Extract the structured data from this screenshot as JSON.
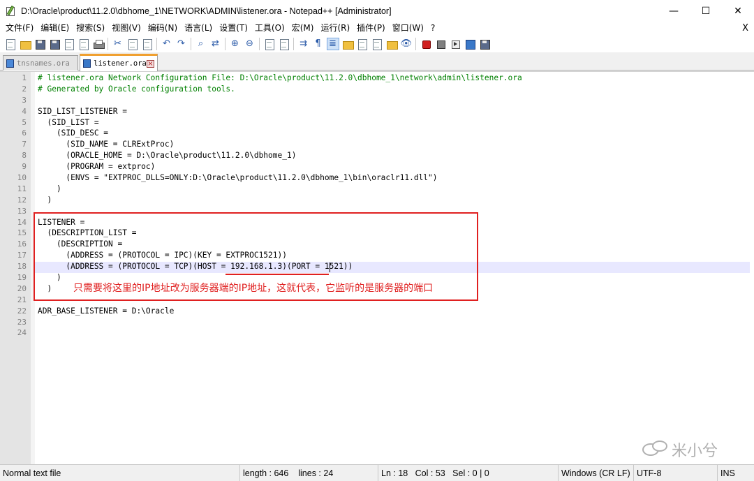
{
  "window": {
    "title": "D:\\Oracle\\product\\11.2.0\\dbhome_1\\NETWORK\\ADMIN\\listener.ora - Notepad++ [Administrator]",
    "minimize": "—",
    "maximize": "☐",
    "close": "✕"
  },
  "menu": {
    "items": [
      "文件(F)",
      "编辑(E)",
      "搜索(S)",
      "视图(V)",
      "编码(N)",
      "语言(L)",
      "设置(T)",
      "工具(O)",
      "宏(M)",
      "运行(R)",
      "插件(P)",
      "窗口(W)",
      "?"
    ],
    "close_doc": "X"
  },
  "toolbar": {
    "icons": [
      "new-file-icon",
      "open-file-icon",
      "save-icon",
      "save-all-icon",
      "close-icon",
      "close-all-icon",
      "print-icon",
      "cut-icon",
      "copy-icon",
      "paste-icon",
      "undo-icon",
      "redo-icon",
      "find-icon",
      "replace-icon",
      "zoom-in-icon",
      "zoom-out-icon",
      "sync-vertical-icon",
      "sync-horizontal-icon",
      "word-wrap-icon",
      "show-all-chars-icon",
      "indent-guide-icon",
      "user-lang-icon",
      "doc-map-icon",
      "function-list-icon",
      "folder-workspace-icon",
      "monitoring-icon",
      "record-macro-icon",
      "stop-macro-icon",
      "play-macro-icon",
      "run-macro-multiple-icon",
      "save-macro-icon"
    ]
  },
  "tabs": [
    {
      "label": "tnsnames.ora",
      "active": false
    },
    {
      "label": "listener.ora",
      "active": true
    }
  ],
  "editor": {
    "line_numbers": [
      "1",
      "2",
      "3",
      "4",
      "5",
      "6",
      "7",
      "8",
      "9",
      "10",
      "11",
      "12",
      "13",
      "14",
      "15",
      "16",
      "17",
      "18",
      "19",
      "20",
      "21",
      "22",
      "23",
      "24"
    ],
    "lines": [
      "# listener.ora Network Configuration File: D:\\Oracle\\product\\11.2.0\\dbhome_1\\network\\admin\\listener.ora",
      "# Generated by Oracle configuration tools.",
      "",
      "SID_LIST_LISTENER =",
      "  (SID_LIST =",
      "    (SID_DESC =",
      "      (SID_NAME = CLRExtProc)",
      "      (ORACLE_HOME = D:\\Oracle\\product\\11.2.0\\dbhome_1)",
      "      (PROGRAM = extproc)",
      "      (ENVS = \"EXTPROC_DLLS=ONLY:D:\\Oracle\\product\\11.2.0\\dbhome_1\\bin\\oraclr11.dll\")",
      "    )",
      "  )",
      "",
      "LISTENER =",
      "  (DESCRIPTION_LIST =",
      "    (DESCRIPTION =",
      "      (ADDRESS = (PROTOCOL = IPC)(KEY = EXTPROC1521))",
      "      (ADDRESS = (PROTOCOL = TCP)(HOST = 192.168.1.3)(PORT = 1521))",
      "    )",
      "  )",
      "",
      "ADR_BASE_LISTENER = D:\\Oracle",
      "",
      ""
    ],
    "current_line": 18
  },
  "annotation": {
    "text": "只需要将这里的IP地址改为服务器端的IP地址，这就代表，它监听的是服务器的端口",
    "color": "#e02020"
  },
  "watermark": {
    "text": "米小兮"
  },
  "statusbar": {
    "file_type": "Normal text file",
    "length": "length : 646",
    "lines": "lines : 24",
    "ln": "Ln : 18",
    "col": "Col : 53",
    "sel": "Sel : 0 | 0",
    "eol": "Windows (CR LF)",
    "encoding": "UTF-8",
    "mode": "INS"
  }
}
